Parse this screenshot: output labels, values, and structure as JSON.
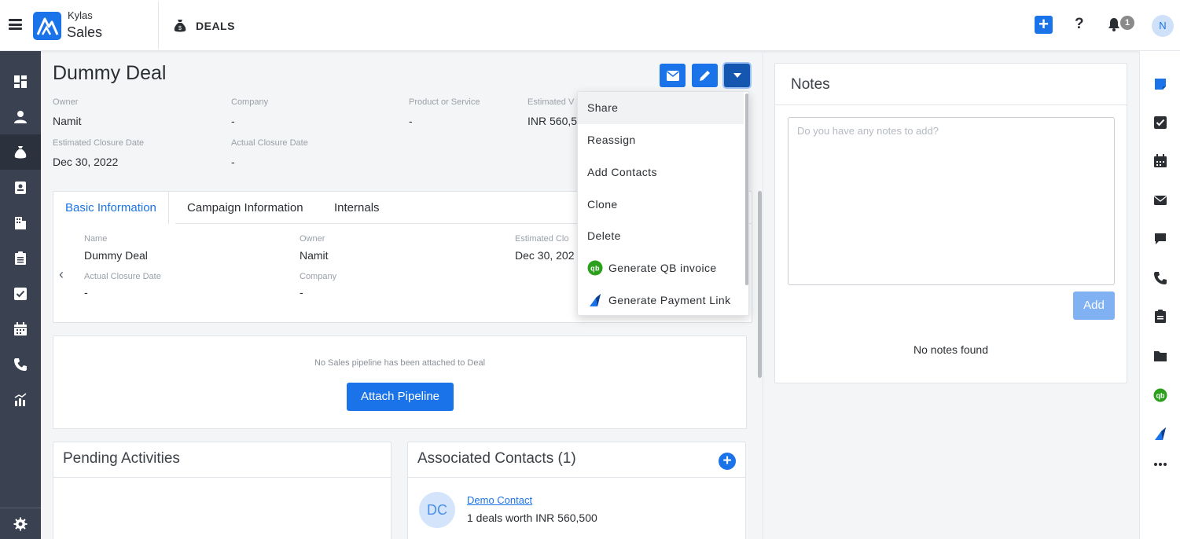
{
  "app": {
    "brand_small": "Kylas",
    "brand_big": "Sales",
    "module": "DEALS"
  },
  "topbar": {
    "notification_count": "1",
    "user_initial": "N"
  },
  "deal": {
    "title": "Dummy Deal",
    "fields": [
      {
        "label": "Owner",
        "value": "Namit"
      },
      {
        "label": "Company",
        "value": "-"
      },
      {
        "label": "Product or Service",
        "value": "-"
      },
      {
        "label": "Estimated V",
        "value": "INR 560,5"
      },
      {
        "label": "Estimated Closure Date",
        "value": "Dec 30, 2022"
      },
      {
        "label": "Actual Closure Date",
        "value": "-"
      }
    ]
  },
  "tabs": [
    "Basic Information",
    "Campaign Information",
    "Internals"
  ],
  "basic_info": [
    {
      "label": "Name",
      "value": "Dummy Deal"
    },
    {
      "label": "Owner",
      "value": "Namit"
    },
    {
      "label": "Estimated Clo",
      "value": "Dec 30, 202"
    },
    {
      "label": "Actual Closure Date",
      "value": "-"
    },
    {
      "label": "Company",
      "value": "-"
    }
  ],
  "pipeline": {
    "message": "No Sales pipeline has been attached to Deal",
    "button": "Attach Pipeline"
  },
  "pending": {
    "title": "Pending Activities"
  },
  "contacts": {
    "title": "Associated Contacts (1)",
    "items": [
      {
        "initials": "DC",
        "name": "Demo Contact",
        "summary": "1 deals worth INR 560,500"
      }
    ]
  },
  "notes": {
    "title": "Notes",
    "placeholder": "Do you have any notes to add?",
    "add_label": "Add",
    "empty": "No notes found"
  },
  "menu": {
    "items": [
      {
        "label": "Share",
        "icon": ""
      },
      {
        "label": "Reassign",
        "icon": ""
      },
      {
        "label": "Add Contacts",
        "icon": ""
      },
      {
        "label": "Clone",
        "icon": ""
      },
      {
        "label": "Delete",
        "icon": ""
      },
      {
        "label": "Generate QB invoice",
        "icon": "quickbooks-icon"
      },
      {
        "label": "Generate Payment Link",
        "icon": "payment-link-icon"
      }
    ]
  },
  "colors": {
    "primary": "#1a73e8",
    "sidebar": "#3a4150",
    "sidebar_active": "#2b313d",
    "quickbooks": "#2ca01c"
  }
}
